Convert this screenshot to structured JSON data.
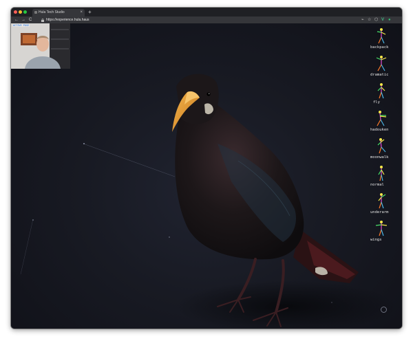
{
  "browser": {
    "tab_title": "Hula Tech Studio",
    "tab_close": "×",
    "new_tab": "+",
    "lock_icon": "lock-icon",
    "url": "https://experience.hula.haus",
    "nav": {
      "back": "←",
      "forward": "→",
      "reload": "C"
    },
    "extensions": {
      "key": "⌁",
      "star": "☆",
      "shield": "⬡",
      "vue": "V",
      "user": "●"
    }
  },
  "webcam": {
    "overlay_label": "ACTIVE POSE"
  },
  "poses": [
    {
      "label": "backpack"
    },
    {
      "label": "dramatic"
    },
    {
      "label": "fly"
    },
    {
      "label": "hadouken"
    },
    {
      "label": "moonwalk"
    },
    {
      "label": "normal"
    },
    {
      "label": "underarm"
    },
    {
      "label": "wings"
    }
  ],
  "colors": {
    "background": "#181a23",
    "bird_body": "#1a1517",
    "beak": "#e7a23a",
    "pose_skeleton_1": "#e94bd8",
    "pose_skeleton_2": "#f7e84a",
    "pose_skeleton_3": "#4be36b"
  }
}
